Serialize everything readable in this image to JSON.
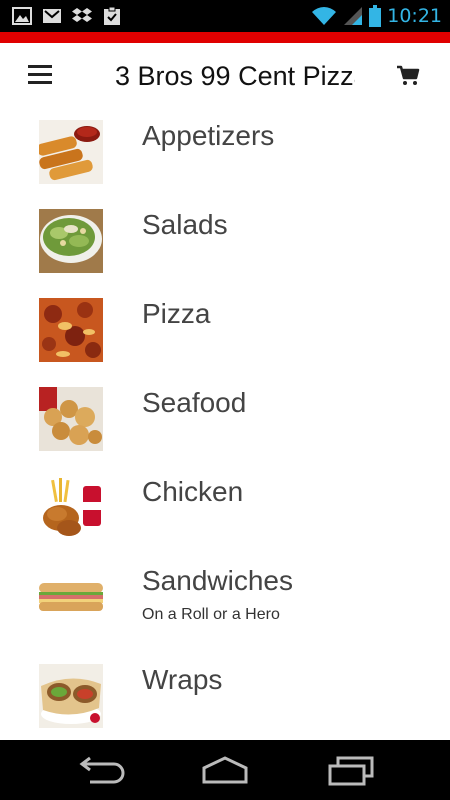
{
  "status": {
    "time": "10:21",
    "left_icons": [
      "gallery-icon",
      "gmail-icon",
      "dropbox-icon",
      "clipboard-icon"
    ],
    "right_icons": [
      "wifi-icon",
      "signal-icon",
      "battery-icon"
    ]
  },
  "header": {
    "title": "3 Bros 99 Cent Pizza",
    "accent_color": "#e00000"
  },
  "menu": {
    "categories": [
      {
        "label": "Appetizers",
        "subtitle": ""
      },
      {
        "label": "Salads",
        "subtitle": ""
      },
      {
        "label": "Pizza",
        "subtitle": ""
      },
      {
        "label": "Seafood",
        "subtitle": ""
      },
      {
        "label": "Chicken",
        "subtitle": ""
      },
      {
        "label": "Sandwiches",
        "subtitle": "On a Roll or a Hero"
      },
      {
        "label": "Wraps",
        "subtitle": ""
      }
    ]
  },
  "navbar": {
    "icons": [
      "back-icon",
      "home-icon",
      "recent-apps-icon"
    ]
  }
}
